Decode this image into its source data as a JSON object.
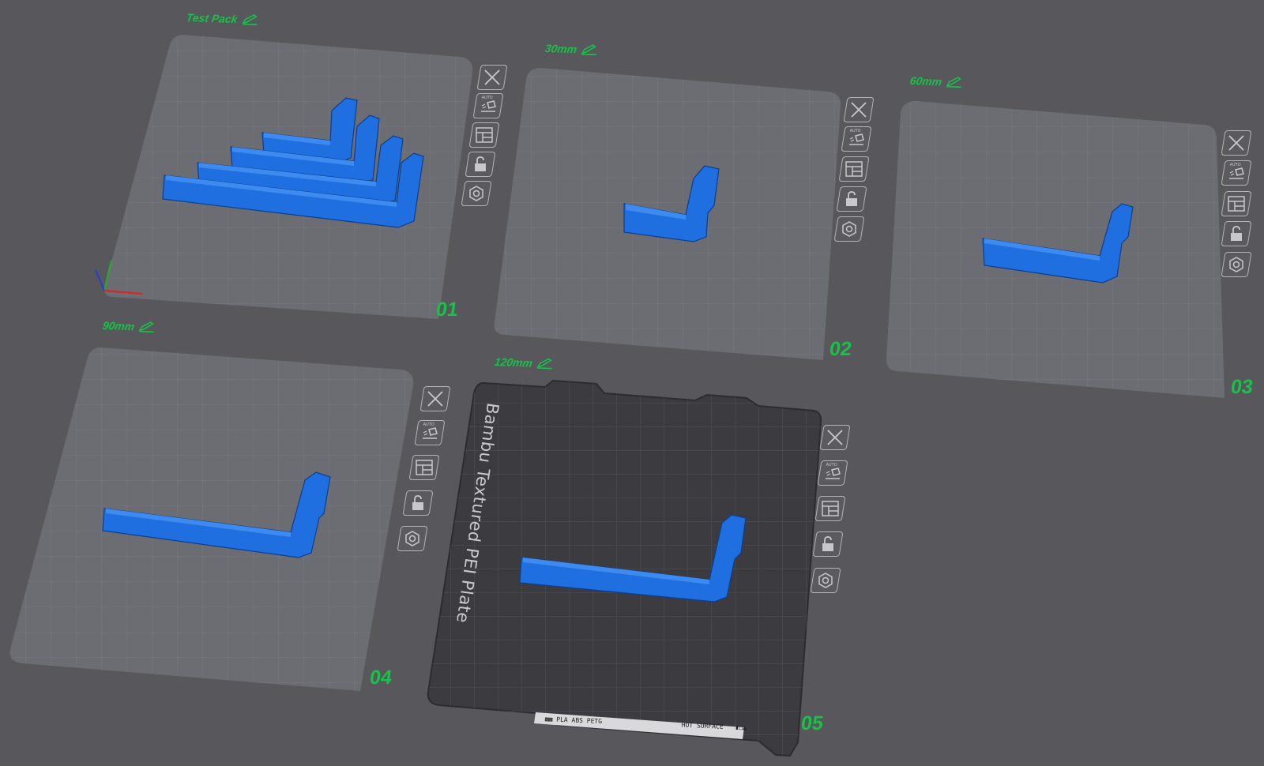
{
  "plates": [
    {
      "number": "01",
      "name": "Test Pack",
      "models": 4
    },
    {
      "number": "02",
      "name": "30mm",
      "models": 1
    },
    {
      "number": "03",
      "name": "60mm",
      "models": 1
    },
    {
      "number": "04",
      "name": "90mm",
      "models": 1
    },
    {
      "number": "05",
      "name": "120mm",
      "models": 1
    }
  ],
  "plate_toolbar": {
    "close": "close-icon",
    "auto_orient": "auto-orient-icon",
    "auto_orient_text": "AUTO",
    "arrange": "arrange-icon",
    "lock": "lock-icon",
    "settings": "settings-icon"
  },
  "build_sheet": {
    "label": "Bambu Textured PEI Plate",
    "strip_materials": "PLA ABS PETG",
    "strip_hot": "HOT",
    "strip_surface": "SURFACE"
  },
  "colors": {
    "background": "#57575c",
    "plate": "#6a6a71",
    "model": "#1f6fe0",
    "accent": "#16c247",
    "pei_sheet": "#3c3c41"
  }
}
